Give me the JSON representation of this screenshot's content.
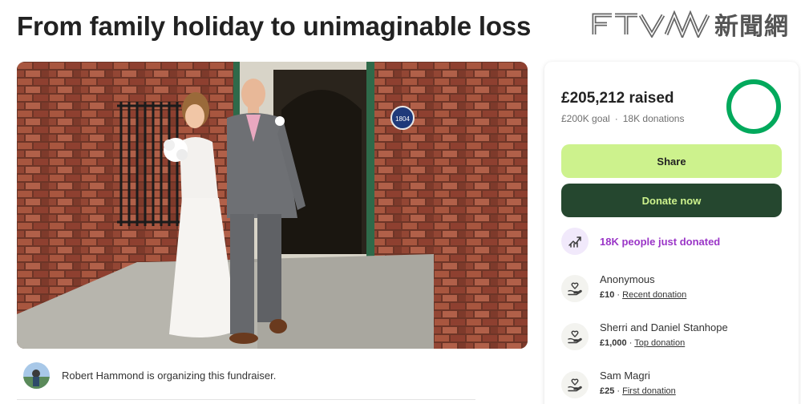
{
  "page": {
    "title": "From family holiday to unimaginable loss"
  },
  "logo": {
    "latin": "FTVN",
    "chinese": "新聞網",
    "icon": "ftvn-logo-icon"
  },
  "photo": {
    "description_icon": "wedding-photo",
    "plaque_text": "1804"
  },
  "organizer": {
    "text": "Robert Hammond is organizing this fundraiser."
  },
  "sidebar": {
    "raised": "£205,212 raised",
    "goal": "£200K goal",
    "donations": "18K donations",
    "progress_fraction": 1.0,
    "share_label": "Share",
    "donate_label": "Donate now",
    "trend_text": "18K people just donated",
    "donors": [
      {
        "name": "Anonymous",
        "amount": "£10",
        "tag": "Recent donation"
      },
      {
        "name": "Sherri and Daniel Stanhope",
        "amount": "£1,000",
        "tag": "Top donation"
      },
      {
        "name": "Sam Magri",
        "amount": "£25",
        "tag": "First donation"
      }
    ]
  },
  "colors": {
    "accent_green": "#02a95c",
    "share_bg": "#cdf28d",
    "donate_bg": "#25472f",
    "trend_purple": "#9a35c7"
  }
}
